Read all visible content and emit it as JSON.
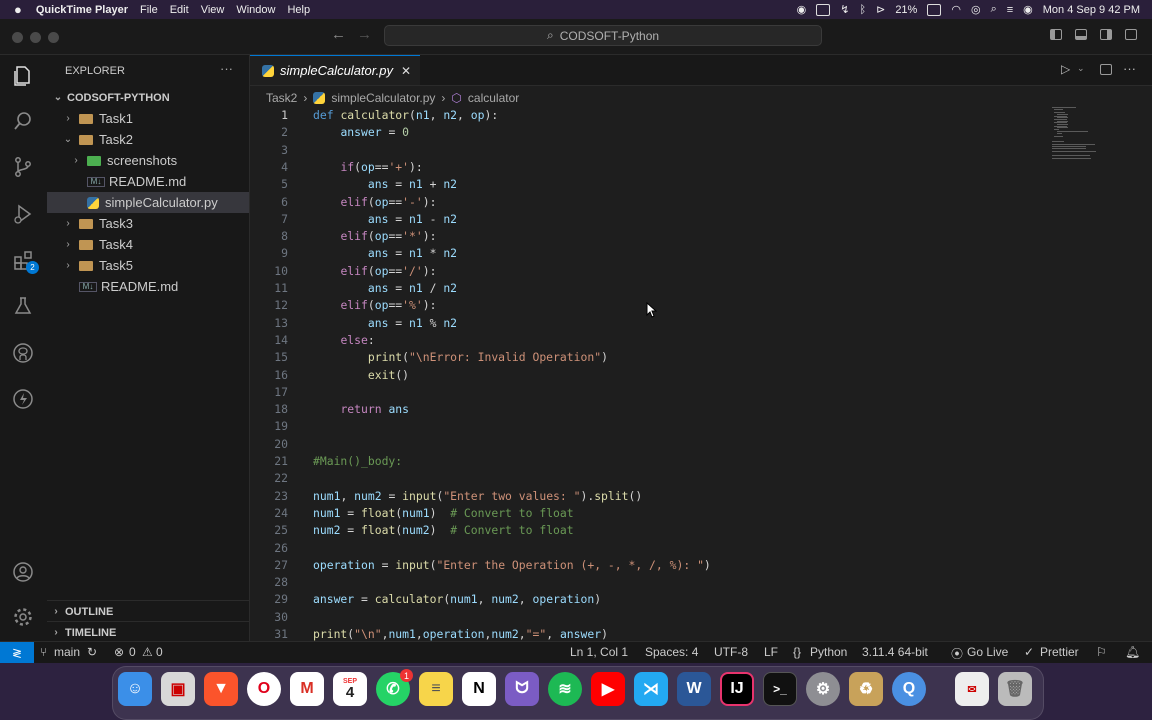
{
  "menubar": {
    "app_name": "QuickTime Player",
    "items": [
      "File",
      "Edit",
      "View",
      "Window",
      "Help"
    ],
    "battery": "21%",
    "clock": "Mon 4 Sep  9 42 PM"
  },
  "window": {
    "search_text": "CODSOFT-Python"
  },
  "activity": {
    "extensions_badge": "2"
  },
  "sidebar": {
    "title": "EXPLORER",
    "more": "···",
    "root": "CODSOFT-PYTHON",
    "items": [
      {
        "label": "Task1",
        "kind": "folder",
        "expanded": false
      },
      {
        "label": "Task2",
        "kind": "folder",
        "expanded": true
      },
      {
        "label": "screenshots",
        "kind": "folder",
        "expanded": false
      },
      {
        "label": "README.md",
        "kind": "md"
      },
      {
        "label": "simpleCalculator.py",
        "kind": "py",
        "selected": true
      },
      {
        "label": "Task3",
        "kind": "folder",
        "expanded": false
      },
      {
        "label": "Task4",
        "kind": "folder",
        "expanded": false
      },
      {
        "label": "Task5",
        "kind": "folder",
        "expanded": false
      },
      {
        "label": "README.md",
        "kind": "md"
      }
    ],
    "outline": "OUTLINE",
    "timeline": "TIMELINE"
  },
  "editor": {
    "tab_label": "simpleCalculator.py",
    "tab_close": "✕",
    "breadcrumb": {
      "folder": "Task2",
      "file": "simpleCalculator.py",
      "symbol": "calculator"
    },
    "line_numbers": [
      "1",
      "2",
      "3",
      "4",
      "5",
      "6",
      "7",
      "8",
      "9",
      "10",
      "11",
      "12",
      "13",
      "14",
      "15",
      "16",
      "17",
      "18",
      "19",
      "20",
      "21",
      "22",
      "23",
      "24",
      "25",
      "26",
      "27",
      "28",
      "29",
      "30",
      "31"
    ],
    "lines": [
      "def calculator(n1, n2, op):",
      "    answer = 0",
      "",
      "    if(op=='+'):",
      "        ans = n1 + n2",
      "    elif(op=='-'):",
      "        ans = n1 - n2",
      "    elif(op=='*'):",
      "        ans = n1 * n2",
      "    elif(op=='/'):",
      "        ans = n1 / n2",
      "    elif(op=='%'):",
      "        ans = n1 % n2",
      "    else:",
      "        print(\"\\nError: Invalid Operation\")",
      "        exit()",
      "",
      "    return ans",
      "",
      "",
      "#Main()_body:",
      "",
      "num1, num2 = input(\"Enter two values: \").split()",
      "num1 = float(num1)  # Convert to float",
      "num2 = float(num2)  # Convert to float",
      "",
      "operation = input(\"Enter the Operation (+, -, *, /, %): \")",
      "",
      "answer = calculator(num1, num2, operation)",
      "",
      "print(\"\\n\",num1,operation,num2,\"=\", answer)"
    ]
  },
  "status": {
    "branch": "main",
    "errors": "0",
    "warnings": "0",
    "position": "Ln 1, Col 1",
    "spaces": "Spaces: 4",
    "encoding": "UTF-8",
    "eol": "LF",
    "language": "Python",
    "interpreter": "3.11.4 64-bit",
    "golive": "Go Live",
    "prettier": "Prettier"
  },
  "dock": {
    "calendar_month": "SEP",
    "calendar_day": "4",
    "whatsapp_badge": "1"
  },
  "colors": {
    "accent": "#0078d4",
    "keyword": "#569cd6",
    "function": "#dcdcaa",
    "string": "#ce9178",
    "comment": "#6a9955"
  }
}
